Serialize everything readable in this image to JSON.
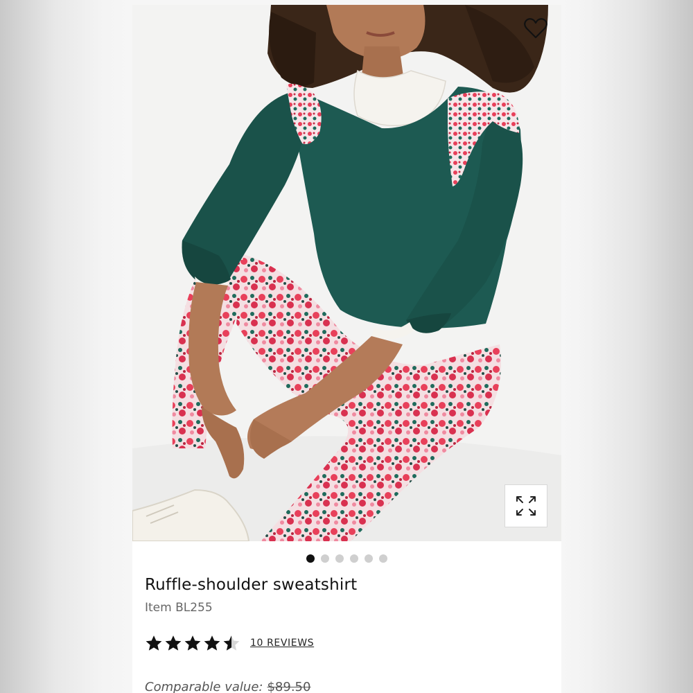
{
  "product": {
    "title": "Ruffle-shoulder sweatshirt",
    "item_number": "Item BL255",
    "rating": 4.5,
    "rating_max": 5,
    "reviews_label": "10 REVIEWS",
    "comparable_label": "Comparable value:",
    "comparable_price": "$89.50"
  },
  "gallery": {
    "image_count": 6,
    "active_index": 0,
    "image_description": "model-in-green-sweatshirt-and-floral-leggings"
  },
  "icons": {
    "wishlist": "heart-icon",
    "expand": "expand-icon",
    "star_full": "star-icon",
    "star_half": "star-half-icon"
  },
  "colors": {
    "sweatshirt": "#1d5a52",
    "leggings_red": "#e8405a",
    "active_dot": "#111111",
    "inactive_dot": "#cfcfcf",
    "star": "#111111"
  }
}
